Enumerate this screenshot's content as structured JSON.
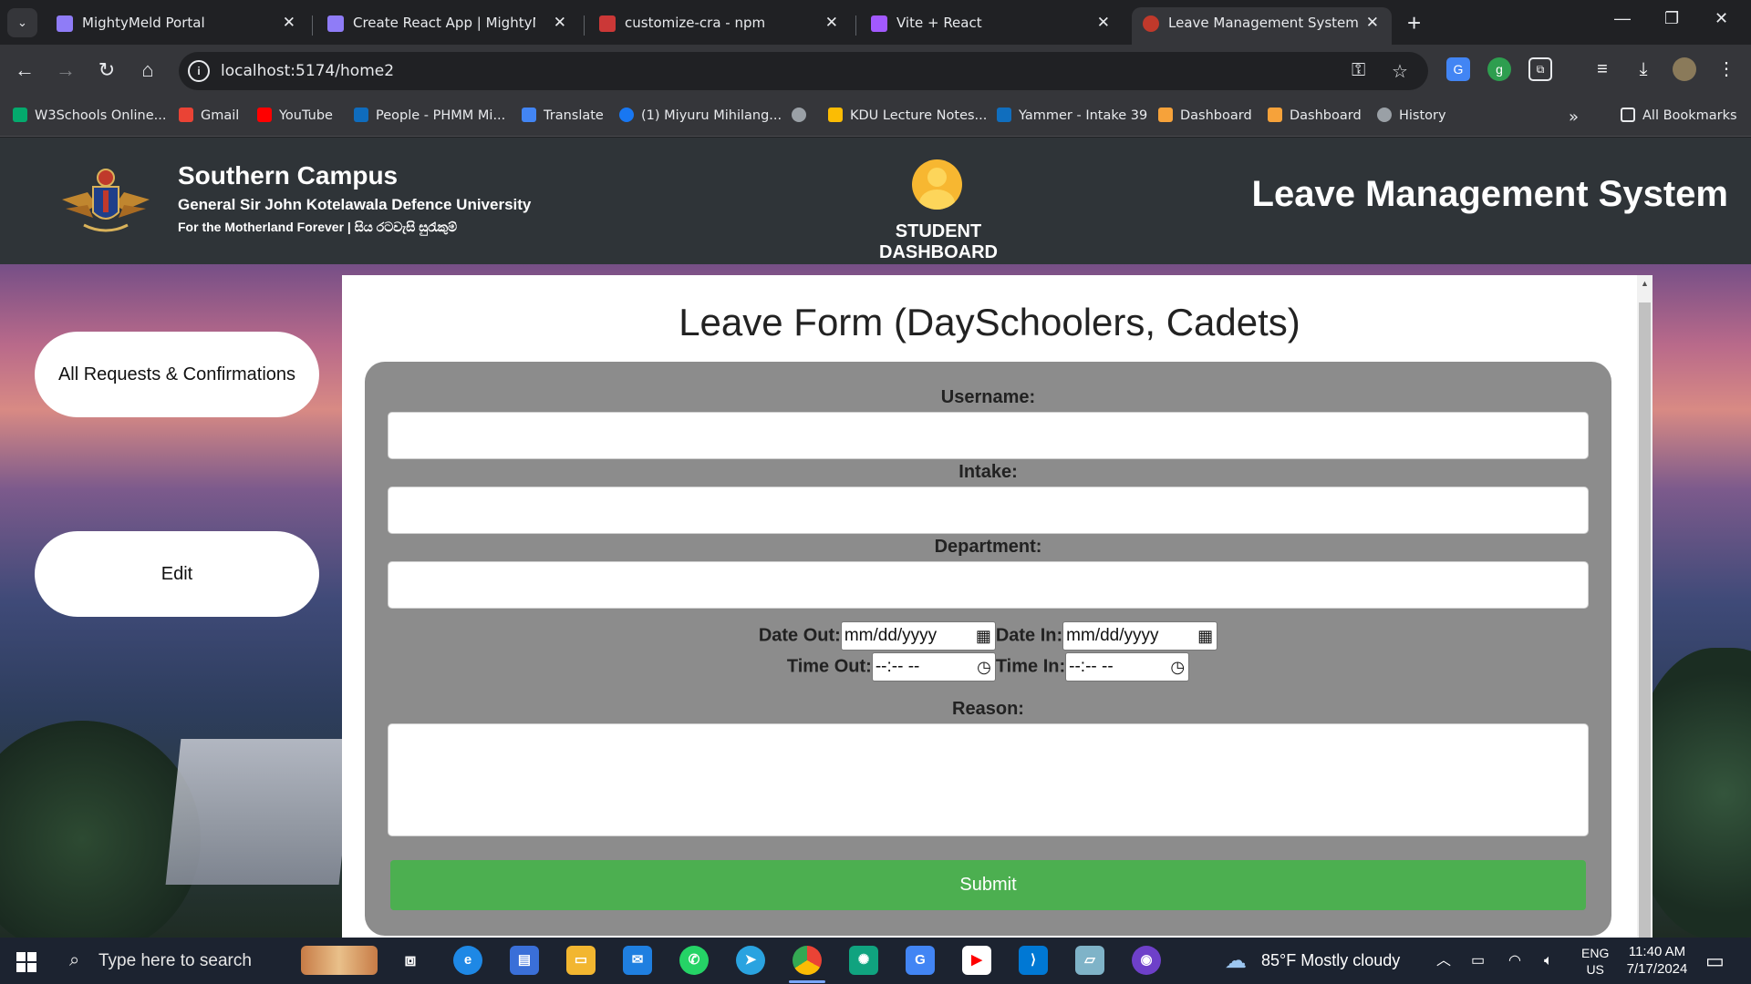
{
  "browser": {
    "tabs": [
      {
        "title": "MightyMeld Portal",
        "favicon_color": "#8f7cf7"
      },
      {
        "title": "Create React App | MightyMeld",
        "favicon_color": "#8f7cf7"
      },
      {
        "title": "customize-cra - npm",
        "favicon_color": "#cb3837"
      },
      {
        "title": "Vite + React",
        "favicon_color": "#a259ff"
      },
      {
        "title": "Leave Management System KDU",
        "favicon_color": "#c0392b"
      }
    ],
    "active_tab_index": 4,
    "url": "localhost:5174/home2",
    "bookmarks": [
      {
        "label": "W3Schools Online...",
        "color": "#04aa6d"
      },
      {
        "label": "Gmail",
        "color": "#ea4335"
      },
      {
        "label": "YouTube",
        "color": "#ff0000"
      },
      {
        "label": "People - PHMM Mi...",
        "color": "#0f6cbd"
      },
      {
        "label": "Translate",
        "color": "#4285f4"
      },
      {
        "label": "(1) Miyuru Mihilang...",
        "color": "#1877f2"
      },
      {
        "label": "",
        "color": "#9aa0a6"
      },
      {
        "label": "KDU Lecture Notes...",
        "color": "#fbbc04"
      },
      {
        "label": "Yammer - Intake 39",
        "color": "#106ebe"
      },
      {
        "label": "Dashboard",
        "color": "#f6a23a"
      },
      {
        "label": "Dashboard",
        "color": "#f6a23a"
      },
      {
        "label": "History",
        "color": "#9aa0a6"
      }
    ],
    "all_bookmarks_label": "All Bookmarks"
  },
  "header": {
    "campus": "Southern Campus",
    "university": "General Sir John Kotelawala Defence University",
    "motto": "For the Motherland Forever | සිය රටවැසි සුරැකුම්",
    "dashboard_label": "STUDENT DASHBOARD",
    "system_title": "Leave Management System"
  },
  "sidebar": {
    "requests_button": "All Requests & Confirmations",
    "edit_button": "Edit"
  },
  "form": {
    "title": "Leave Form (DaySchoolers, Cadets)",
    "username_label": "Username:",
    "username_value": "",
    "intake_label": "Intake:",
    "intake_value": "",
    "department_label": "Department:",
    "department_value": "",
    "date_out_label": "Date Out:",
    "date_out_value": "mm/dd/yyyy",
    "date_in_label": "Date In:",
    "date_in_value": "mm/dd/yyyy",
    "time_out_label": "Time Out:",
    "time_out_value": "--:-- --",
    "time_in_label": "Time In:",
    "time_in_value": "--:-- --",
    "reason_label": "Reason:",
    "reason_value": "",
    "submit_label": "Submit",
    "submit_color": "#4caf50"
  },
  "taskbar": {
    "search_placeholder": "Type here to search",
    "weather": "85°F  Mostly cloudy",
    "lang_top": "ENG",
    "lang_bottom": "US",
    "time": "11:40 AM",
    "date": "7/17/2024"
  }
}
